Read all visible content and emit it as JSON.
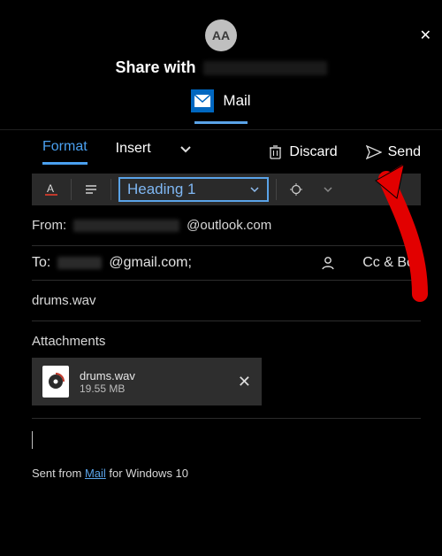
{
  "header": {
    "avatar_initials": "AA",
    "share_label": "Share with",
    "app_name": "Mail"
  },
  "tabs": {
    "format": "Format",
    "insert": "Insert",
    "discard": "Discard",
    "send": "Send"
  },
  "format_bar": {
    "style_selected": "Heading 1"
  },
  "fields": {
    "from_label": "From:",
    "from_domain": "@outlook.com",
    "to_label": "To:",
    "to_domain": "@gmail.com;",
    "ccbcc": "Cc & Bcc",
    "subject": "drums.wav",
    "attachments_label": "Attachments"
  },
  "attachment": {
    "name": "drums.wav",
    "size": "19.55 MB"
  },
  "footer": {
    "prefix": "Sent from ",
    "link": "Mail",
    "suffix": " for Windows 10"
  }
}
